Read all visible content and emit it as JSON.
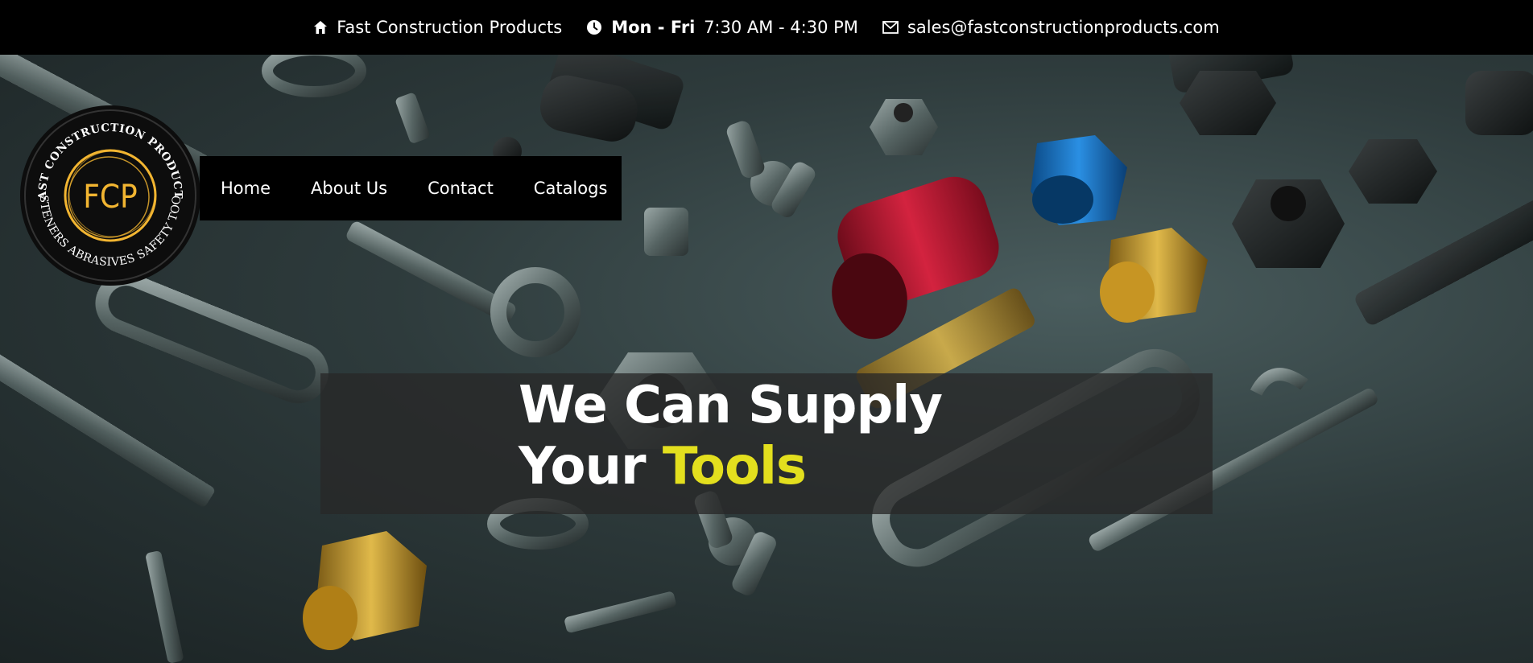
{
  "topbar": {
    "company": "Fast Construction Products",
    "days": "Mon - Fri",
    "hours": "7:30 AM - 4:30 PM",
    "email": "sales@fastconstructionproducts.com",
    "icons": [
      "home-icon",
      "clock-icon",
      "mail-icon"
    ]
  },
  "logo": {
    "initials": "FCP",
    "top_arc_text": "FAST CONSTRUCTION PRODUCTS",
    "bottom_arc_text": "FASTENERS ABRASIVES SAFETY TOOLS"
  },
  "nav": {
    "items": [
      {
        "label": "Home"
      },
      {
        "label": "About Us"
      },
      {
        "label": "Contact"
      },
      {
        "label": "Catalogs"
      }
    ]
  },
  "hero": {
    "line1": "We Can Supply",
    "line2_prefix": "Your ",
    "line2_accent": "Tools"
  },
  "colors": {
    "topbar_bg": "#000000",
    "accent_yellow": "#e3df1e",
    "logo_gold": "#f2b531"
  }
}
